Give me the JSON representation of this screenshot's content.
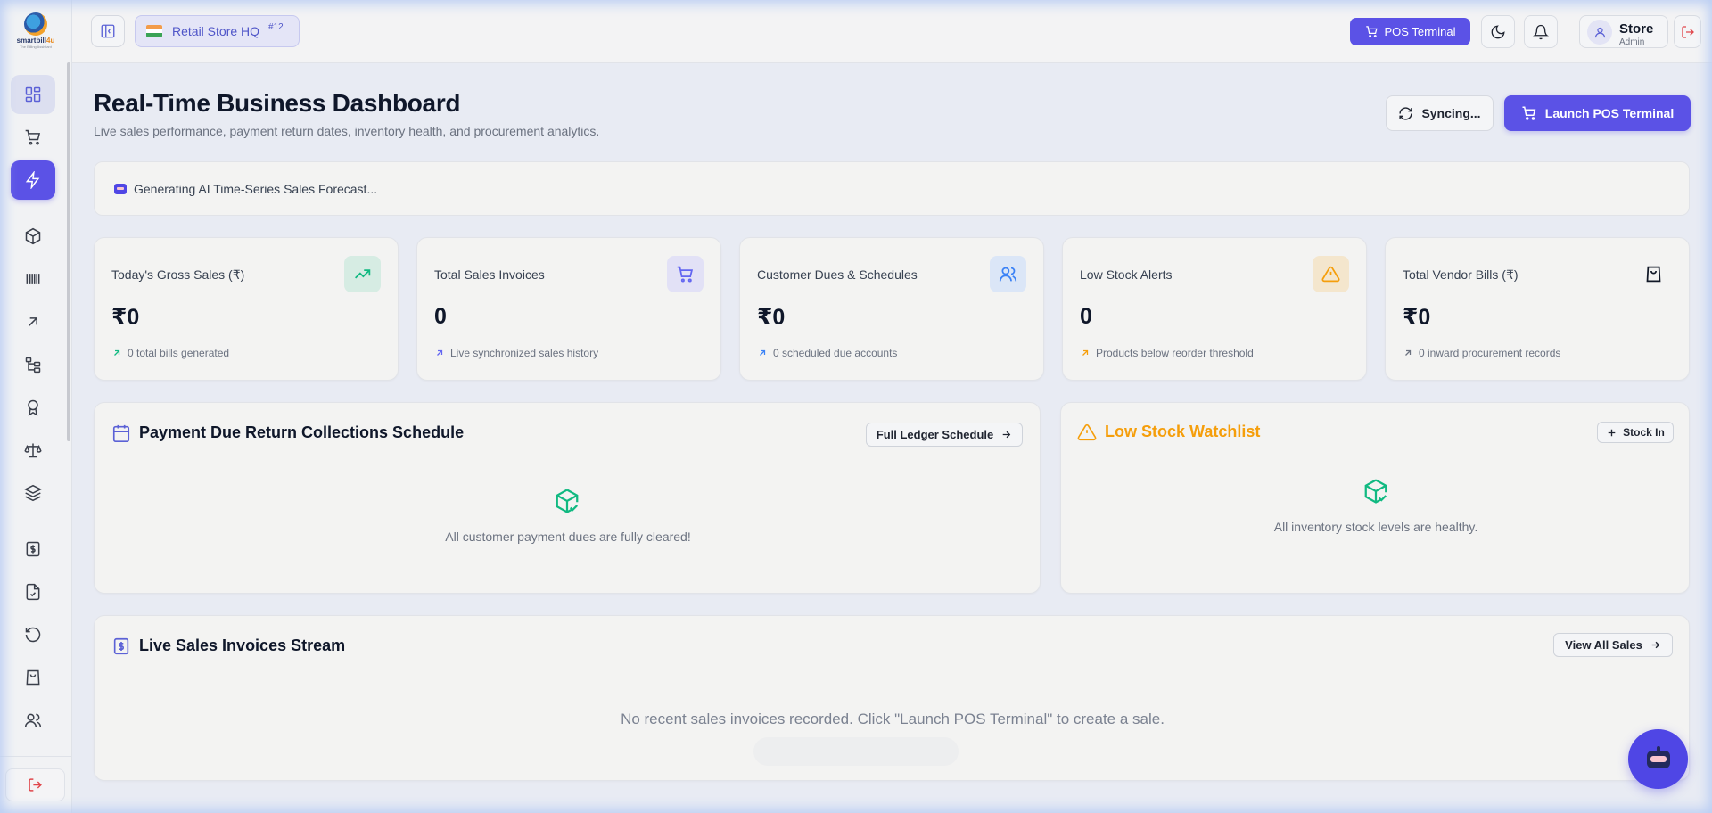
{
  "brand": {
    "logo_name": "smartbill",
    "logo_suffix": "4u",
    "logo_tagline": "The Billing Assistant"
  },
  "sidebar": {
    "items": [
      {
        "name": "dashboard",
        "icon": "layout-grid-icon"
      },
      {
        "name": "cart",
        "icon": "shopping-cart-icon"
      },
      {
        "name": "quick-pos",
        "icon": "lightning-icon"
      },
      {
        "name": "products",
        "icon": "cube-icon"
      },
      {
        "name": "barcodes",
        "icon": "barcode-icon"
      },
      {
        "name": "trends",
        "icon": "arrow-up-right-icon"
      },
      {
        "name": "categories",
        "icon": "hierarchy-icon"
      },
      {
        "name": "awards",
        "icon": "award-icon"
      },
      {
        "name": "ledger",
        "icon": "scale-icon"
      },
      {
        "name": "layers",
        "icon": "layers-icon"
      },
      {
        "name": "invoices",
        "icon": "receipt-dollar-icon"
      },
      {
        "name": "reports",
        "icon": "file-check-icon"
      },
      {
        "name": "returns",
        "icon": "rotate-ccw-icon"
      },
      {
        "name": "purchases",
        "icon": "shopping-bag-icon"
      },
      {
        "name": "customers",
        "icon": "users-icon"
      }
    ]
  },
  "topbar": {
    "store_name": "Retail Store HQ",
    "store_id": "#12",
    "pos_button": "POS Terminal",
    "user_name": "Store",
    "user_role": "Admin"
  },
  "header": {
    "title": "Real-Time Business Dashboard",
    "subtitle": "Live sales performance, payment return dates, inventory health, and procurement analytics.",
    "sync_button": "Syncing...",
    "launch_button": "Launch POS Terminal"
  },
  "forecast": {
    "text": "Generating AI Time-Series Sales Forecast..."
  },
  "stats": [
    {
      "label": "Today's Gross Sales (₹)",
      "value": "₹0",
      "foot": "0 total bills generated",
      "icon": "trending-up-icon",
      "color": "#10b981",
      "bg": "#d6ece3"
    },
    {
      "label": "Total Sales Invoices",
      "value": "0",
      "foot": "Live synchronized sales history",
      "icon": "shopping-cart-icon",
      "color": "#6366f1",
      "bg": "#e2e1f6"
    },
    {
      "label": "Customer Dues & Schedules",
      "value": "₹0",
      "foot": "0 scheduled due accounts",
      "icon": "users-icon",
      "color": "#3b82f6",
      "bg": "#dbe6f7"
    },
    {
      "label": "Low Stock Alerts",
      "value": "0",
      "foot": "Products below reorder threshold",
      "icon": "alert-triangle-icon",
      "color": "#f59e0b",
      "bg": "#f4e6cd"
    },
    {
      "label": "Total Vendor Bills (₹)",
      "value": "₹0",
      "foot": "0 inward procurement records",
      "icon": "shopping-bag-icon",
      "color": "#111827",
      "bg": "transparent"
    }
  ],
  "payments_panel": {
    "title": "Payment Due Return Collections Schedule",
    "button": "Full Ledger Schedule",
    "empty": "All customer payment dues are fully cleared!"
  },
  "stock_panel": {
    "title": "Low Stock Watchlist",
    "button": "Stock In",
    "empty": "All inventory stock levels are healthy."
  },
  "sales_panel": {
    "title": "Live Sales Invoices Stream",
    "button": "View All Sales",
    "empty": "No recent sales invoices recorded. Click \"Launch POS Terminal\" to create a sale."
  },
  "colors": {
    "accent": "#5b52e6",
    "success": "#10b981",
    "warning": "#f59e0b",
    "danger": "#e0474c"
  }
}
